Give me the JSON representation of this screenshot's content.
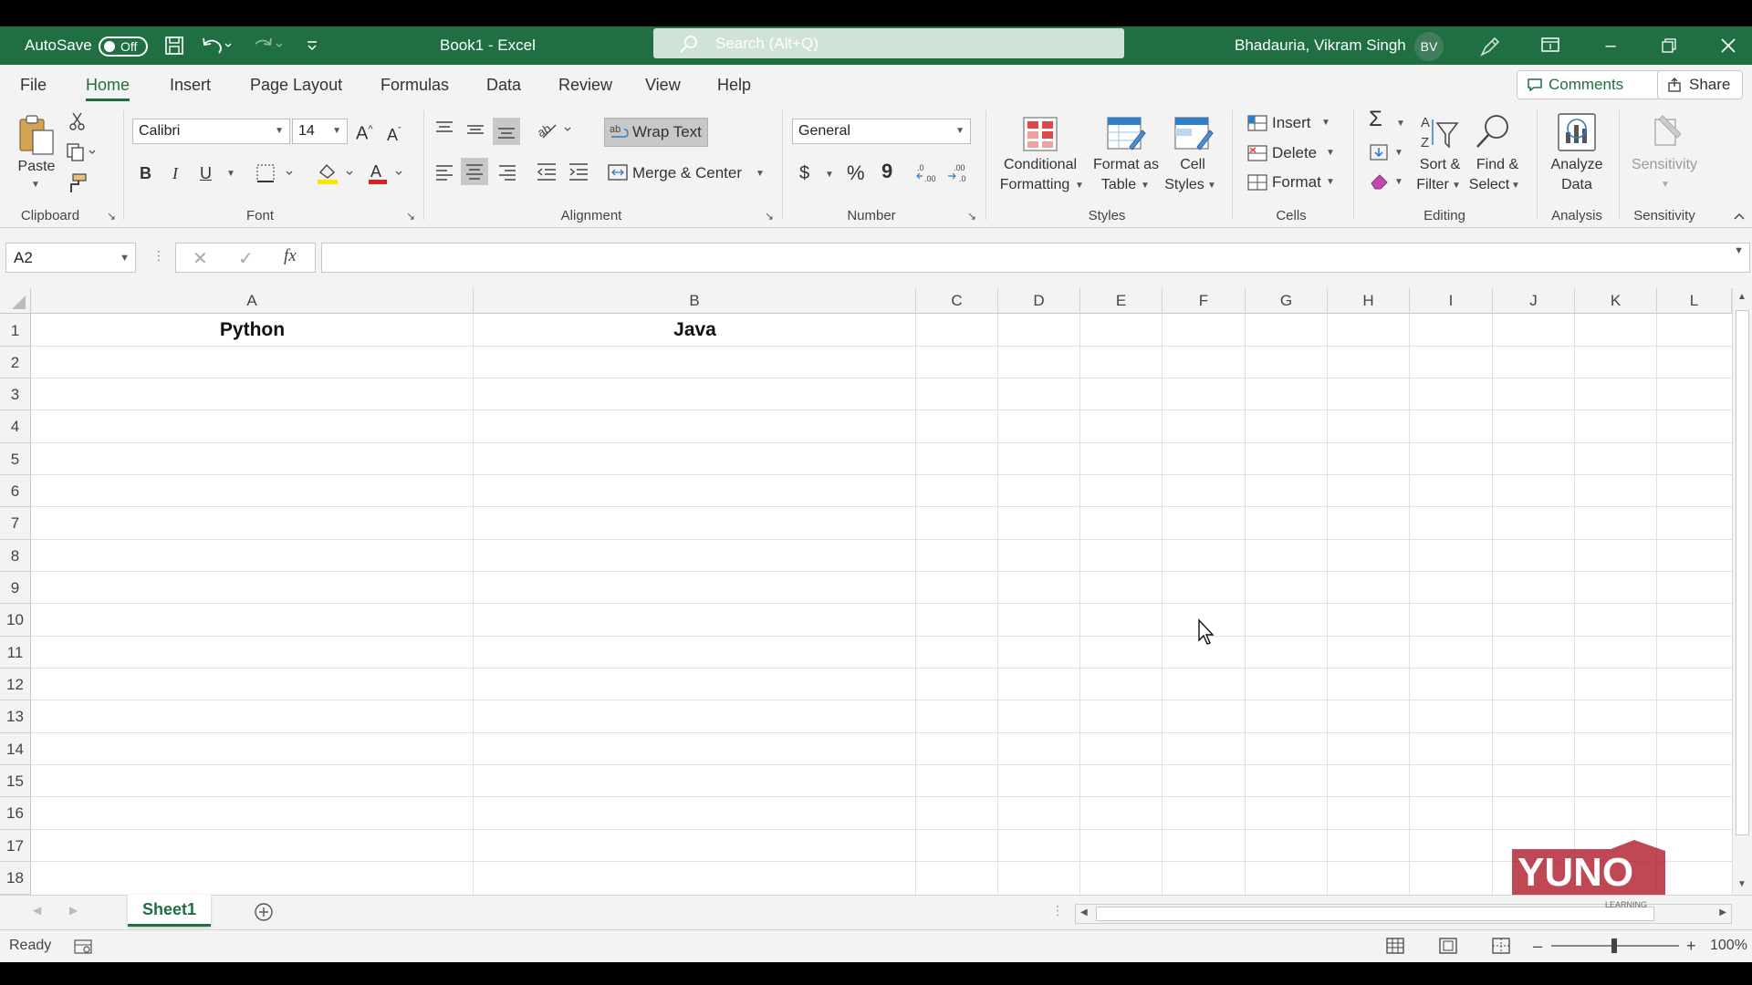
{
  "titlebar": {
    "autosave_label": "AutoSave",
    "autosave_state": "Off",
    "doc_title": "Book1  -  Excel",
    "search_placeholder": "Search (Alt+Q)",
    "user_name": "Bhadauria, Vikram Singh",
    "user_initials": "BV"
  },
  "tabs": [
    {
      "label": "File"
    },
    {
      "label": "Home"
    },
    {
      "label": "Insert"
    },
    {
      "label": "Page Layout"
    },
    {
      "label": "Formulas"
    },
    {
      "label": "Data"
    },
    {
      "label": "Review"
    },
    {
      "label": "View"
    },
    {
      "label": "Help"
    }
  ],
  "tab_buttons": {
    "comments": "Comments",
    "share": "Share"
  },
  "ribbon": {
    "clipboard": {
      "label": "Clipboard",
      "paste": "Paste"
    },
    "font": {
      "label": "Font",
      "family": "Calibri",
      "size": "14",
      "bold": "B",
      "italic": "I",
      "underline": "U"
    },
    "alignment": {
      "label": "Alignment",
      "wrap_text": "Wrap Text",
      "merge_center": "Merge & Center"
    },
    "number": {
      "label": "Number",
      "format": "General",
      "currency": "$",
      "percent": "%",
      "comma": "9"
    },
    "styles": {
      "label": "Styles",
      "conditional_1": "Conditional",
      "conditional_2": "Formatting",
      "format_table_1": "Format as",
      "format_table_2": "Table",
      "cell_styles_1": "Cell",
      "cell_styles_2": "Styles"
    },
    "cells": {
      "label": "Cells",
      "insert": "Insert",
      "delete": "Delete",
      "format": "Format"
    },
    "editing": {
      "label": "Editing",
      "sort_1": "Sort &",
      "sort_2": "Filter",
      "find_1": "Find &",
      "find_2": "Select"
    },
    "analysis": {
      "label": "Analysis",
      "analyze_1": "Analyze",
      "analyze_2": "Data"
    },
    "sensitivity": {
      "label": "Sensitivity",
      "button": "Sensitivity"
    }
  },
  "formula_bar": {
    "name_box": "A2",
    "fx": "fx",
    "value": ""
  },
  "grid": {
    "columns": [
      "A",
      "B",
      "C",
      "D",
      "E",
      "F",
      "G",
      "H",
      "I",
      "J",
      "K",
      "L"
    ],
    "rows": [
      "1",
      "2",
      "3",
      "4",
      "5",
      "6",
      "7",
      "8",
      "9",
      "10",
      "11",
      "12",
      "13",
      "14",
      "15",
      "16",
      "17",
      "18"
    ],
    "cells": {
      "A1": "Python",
      "B1": "Java"
    }
  },
  "sheets": [
    {
      "name": "Sheet1"
    }
  ],
  "status": {
    "ready": "Ready",
    "zoom": "100%"
  },
  "watermark": {
    "brand": "YUNO",
    "sub": "LEARNING"
  },
  "colors": {
    "excel_green": "#1f6f43",
    "ribbon_bg": "#f3f3f3",
    "grid_line": "#e1e1e1"
  }
}
